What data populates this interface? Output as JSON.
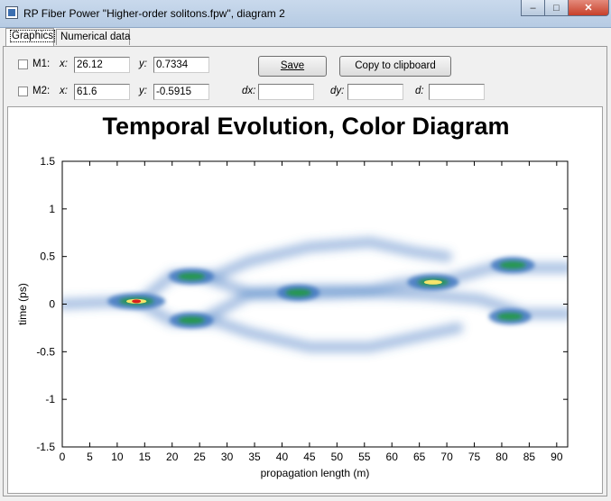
{
  "window": {
    "title": "RP Fiber Power \"Higher-order solitons.fpw\", diagram 2",
    "min_glyph": "–",
    "max_glyph": "□",
    "close_glyph": "✕"
  },
  "tabs": [
    {
      "label": "Graphics",
      "active": true
    },
    {
      "label": "Numerical data",
      "active": false
    }
  ],
  "markers": {
    "m1": {
      "label": "M1:",
      "x_label": "x:",
      "x_value": "26.12",
      "y_label": "y:",
      "y_value": "0.7334"
    },
    "m2": {
      "label": "M2:",
      "x_label": "x:",
      "x_value": "61.6",
      "y_label": "y:",
      "y_value": "-0.5915"
    },
    "dx_label": "dx:",
    "dx_value": "",
    "dy_label": "dy:",
    "dy_value": "",
    "d_label": "d:",
    "d_value": ""
  },
  "buttons": {
    "save": "Save",
    "copy": "Copy to clipboard"
  },
  "chart_data": {
    "type": "heatmap",
    "title": "Temporal Evolution, Color Diagram",
    "xlabel": "propagation length (m)",
    "ylabel": "time (ps)",
    "xlim": [
      0,
      92
    ],
    "ylim": [
      -1.5,
      1.5
    ],
    "x_ticks": [
      "0",
      "5",
      "10",
      "15",
      "20",
      "25",
      "30",
      "35",
      "40",
      "45",
      "50",
      "55",
      "60",
      "65",
      "70",
      "75",
      "80",
      "85",
      "90"
    ],
    "y_ticks": [
      "1.5",
      "1",
      "0.5",
      "0",
      "-0.5",
      "-1",
      "-1.5"
    ],
    "colormap": [
      "#ffffff",
      "#3f77c0",
      "#1e9a3e",
      "#f6e56b",
      "#d8201c"
    ],
    "features": [
      {
        "x": 13.5,
        "y": 0.03,
        "intensity": 1.0
      },
      {
        "x": 23.5,
        "y": 0.29,
        "intensity": 0.5
      },
      {
        "x": 23.5,
        "y": -0.17,
        "intensity": 0.45
      },
      {
        "x": 43,
        "y": 0.12,
        "intensity": 0.4
      },
      {
        "x": 67.5,
        "y": 0.23,
        "intensity": 0.75
      },
      {
        "x": 82,
        "y": 0.41,
        "intensity": 0.45
      },
      {
        "x": 81.5,
        "y": -0.13,
        "intensity": 0.4
      }
    ]
  }
}
